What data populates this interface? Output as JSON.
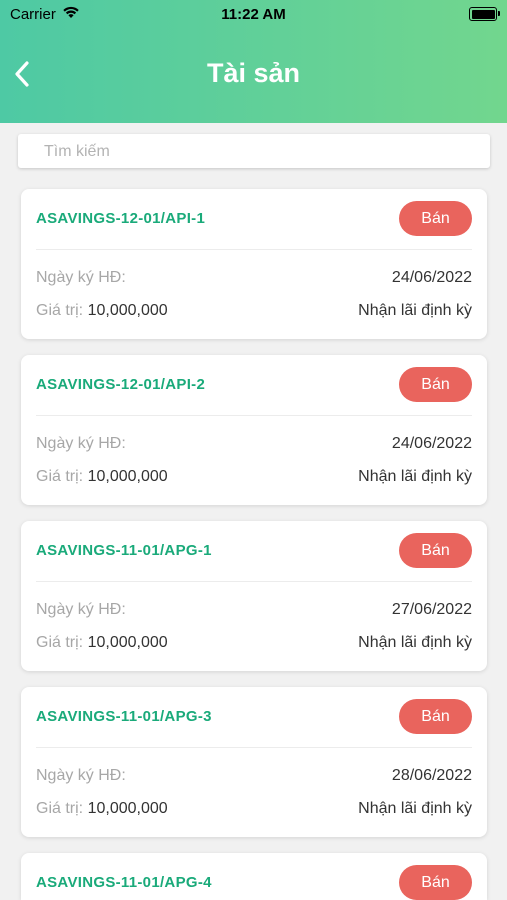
{
  "status_bar": {
    "carrier": "Carrier",
    "time": "11:22 AM"
  },
  "header": {
    "title": "Tài sản"
  },
  "search": {
    "placeholder": "Tìm kiếm",
    "value": ""
  },
  "labels": {
    "date": "Ngày ký HĐ:",
    "value": "Giá trị:"
  },
  "assets": [
    {
      "code": "ASAVINGS-12-01/API-1",
      "action": "Bán",
      "date": "24/06/2022",
      "amount": "10,000,000",
      "type": "Nhận lãi định kỳ"
    },
    {
      "code": "ASAVINGS-12-01/API-2",
      "action": "Bán",
      "date": "24/06/2022",
      "amount": "10,000,000",
      "type": "Nhận lãi định kỳ"
    },
    {
      "code": "ASAVINGS-11-01/APG-1",
      "action": "Bán",
      "date": "27/06/2022",
      "amount": "10,000,000",
      "type": "Nhận lãi định kỳ"
    },
    {
      "code": "ASAVINGS-11-01/APG-3",
      "action": "Bán",
      "date": "28/06/2022",
      "amount": "10,000,000",
      "type": "Nhận lãi định kỳ"
    },
    {
      "code": "ASAVINGS-11-01/APG-4",
      "action": "Bán"
    }
  ],
  "colors": {
    "accent_green": "#1aaa7a",
    "sell_red": "#e9645d",
    "header_from": "#4ec9a4",
    "header_to": "#72d68e"
  }
}
